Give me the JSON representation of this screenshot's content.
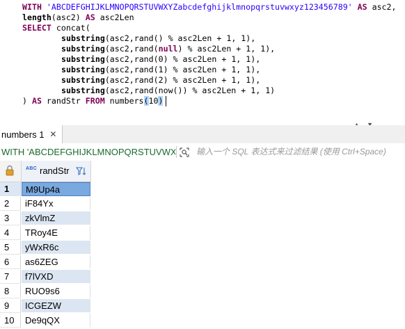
{
  "editor": {
    "line1": {
      "kw1": "WITH",
      "str": "'ABCDEFGHIJKLMNOPQRSTUVWXYZabcdefghijklmnopqrstuvwxyz123456789'",
      "kw2": "AS",
      "rest": "asc2,"
    },
    "line2": {
      "fn": "length",
      "arg": "(asc2)",
      "kw": "AS",
      "rest": "asc2Len"
    },
    "line3": {
      "kw": "SELECT",
      "rest": "concat("
    },
    "substrings": [
      {
        "fn": "substring",
        "pre": "(asc2,rand() % asc2Len + ",
        "n1": "1",
        "mid": ", ",
        "n2": "1",
        "post": "),"
      },
      {
        "fn": "substring",
        "pre": "(asc2,rand(",
        "kwarg": "null",
        "pre2": ") % asc2Len + ",
        "n1": "1",
        "mid": ", ",
        "n2": "1",
        "post": "),"
      },
      {
        "fn": "substring",
        "pre": "(asc2,rand(0) % asc2Len + ",
        "n1": "1",
        "mid": ", ",
        "n2": "1",
        "post": "),"
      },
      {
        "fn": "substring",
        "pre": "(asc2,rand(1) % asc2Len + ",
        "n1": "1",
        "mid": ", ",
        "n2": "1",
        "post": "),"
      },
      {
        "fn": "substring",
        "pre": "(asc2,rand(2) % asc2Len + ",
        "n1": "1",
        "mid": ", ",
        "n2": "1",
        "post": "),"
      },
      {
        "fn": "substring",
        "pre": "(asc2,rand(now()) % asc2Len + ",
        "n1": "1",
        "mid": ", ",
        "n2": "1",
        "post": ")"
      }
    ],
    "last": {
      "pre": ") ",
      "kw1": "AS",
      "mid": " randStr ",
      "kw2": "FROM",
      "fn": " numbers",
      "open": "(",
      "num": "10",
      "close": ")"
    }
  },
  "result_tab": {
    "label": "numbers 1",
    "close": "✕"
  },
  "filter": {
    "query": "WITH 'ABCDEFGHIJKLMNOPQRSTUVWXYZa",
    "placeholder": "输入一个 SQL 表达式来过滤结果 (使用 Ctrl+Space)"
  },
  "grid": {
    "column": {
      "type_badge": "ABC",
      "name": "randStr"
    },
    "rows": [
      {
        "num": "1",
        "value": "M9Up4a"
      },
      {
        "num": "2",
        "value": "iF84Yx"
      },
      {
        "num": "3",
        "value": "zkVlmZ"
      },
      {
        "num": "4",
        "value": "TRoy4E"
      },
      {
        "num": "5",
        "value": "yWxR6c"
      },
      {
        "num": "6",
        "value": "as6ZEG"
      },
      {
        "num": "7",
        "value": "f7lVXD"
      },
      {
        "num": "8",
        "value": "RUO9s6"
      },
      {
        "num": "9",
        "value": "ICGEZW"
      },
      {
        "num": "10",
        "value": "De9qQX"
      }
    ],
    "selected_row": 1
  },
  "colors": {
    "keyword": "#7f0055",
    "string": "#2a00ff",
    "selection": "#7aa9df",
    "stripe": "#dce6f2",
    "filter_text": "#1a6a2a"
  }
}
